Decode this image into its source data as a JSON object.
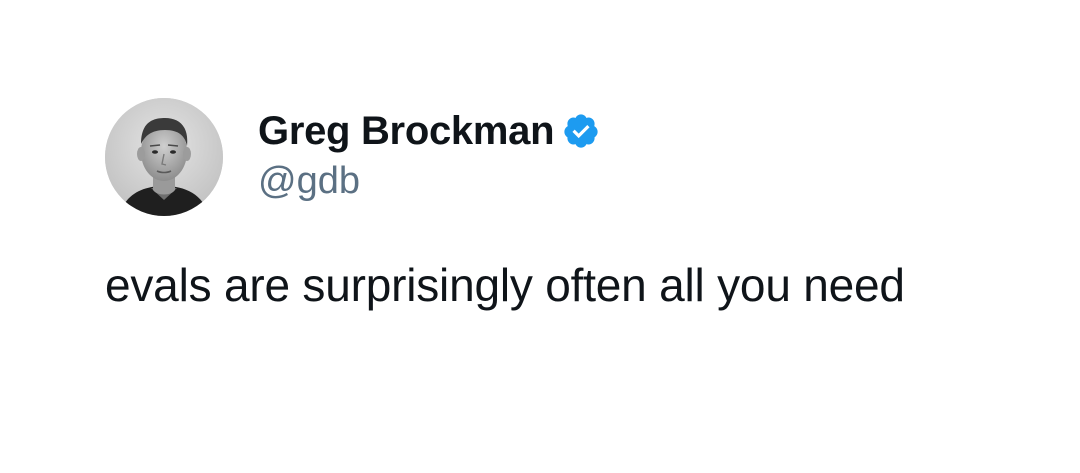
{
  "author": {
    "display_name": "Greg Brockman",
    "handle": "@gdb",
    "verified": true,
    "verified_icon": "verified-badge-icon",
    "avatar": "profile-photo"
  },
  "tweet": {
    "text": "evals are surprisingly often all you need"
  },
  "colors": {
    "name": "#0f1419",
    "handle": "#5b7083",
    "verified": "#1d9bf0",
    "background": "#ffffff"
  }
}
